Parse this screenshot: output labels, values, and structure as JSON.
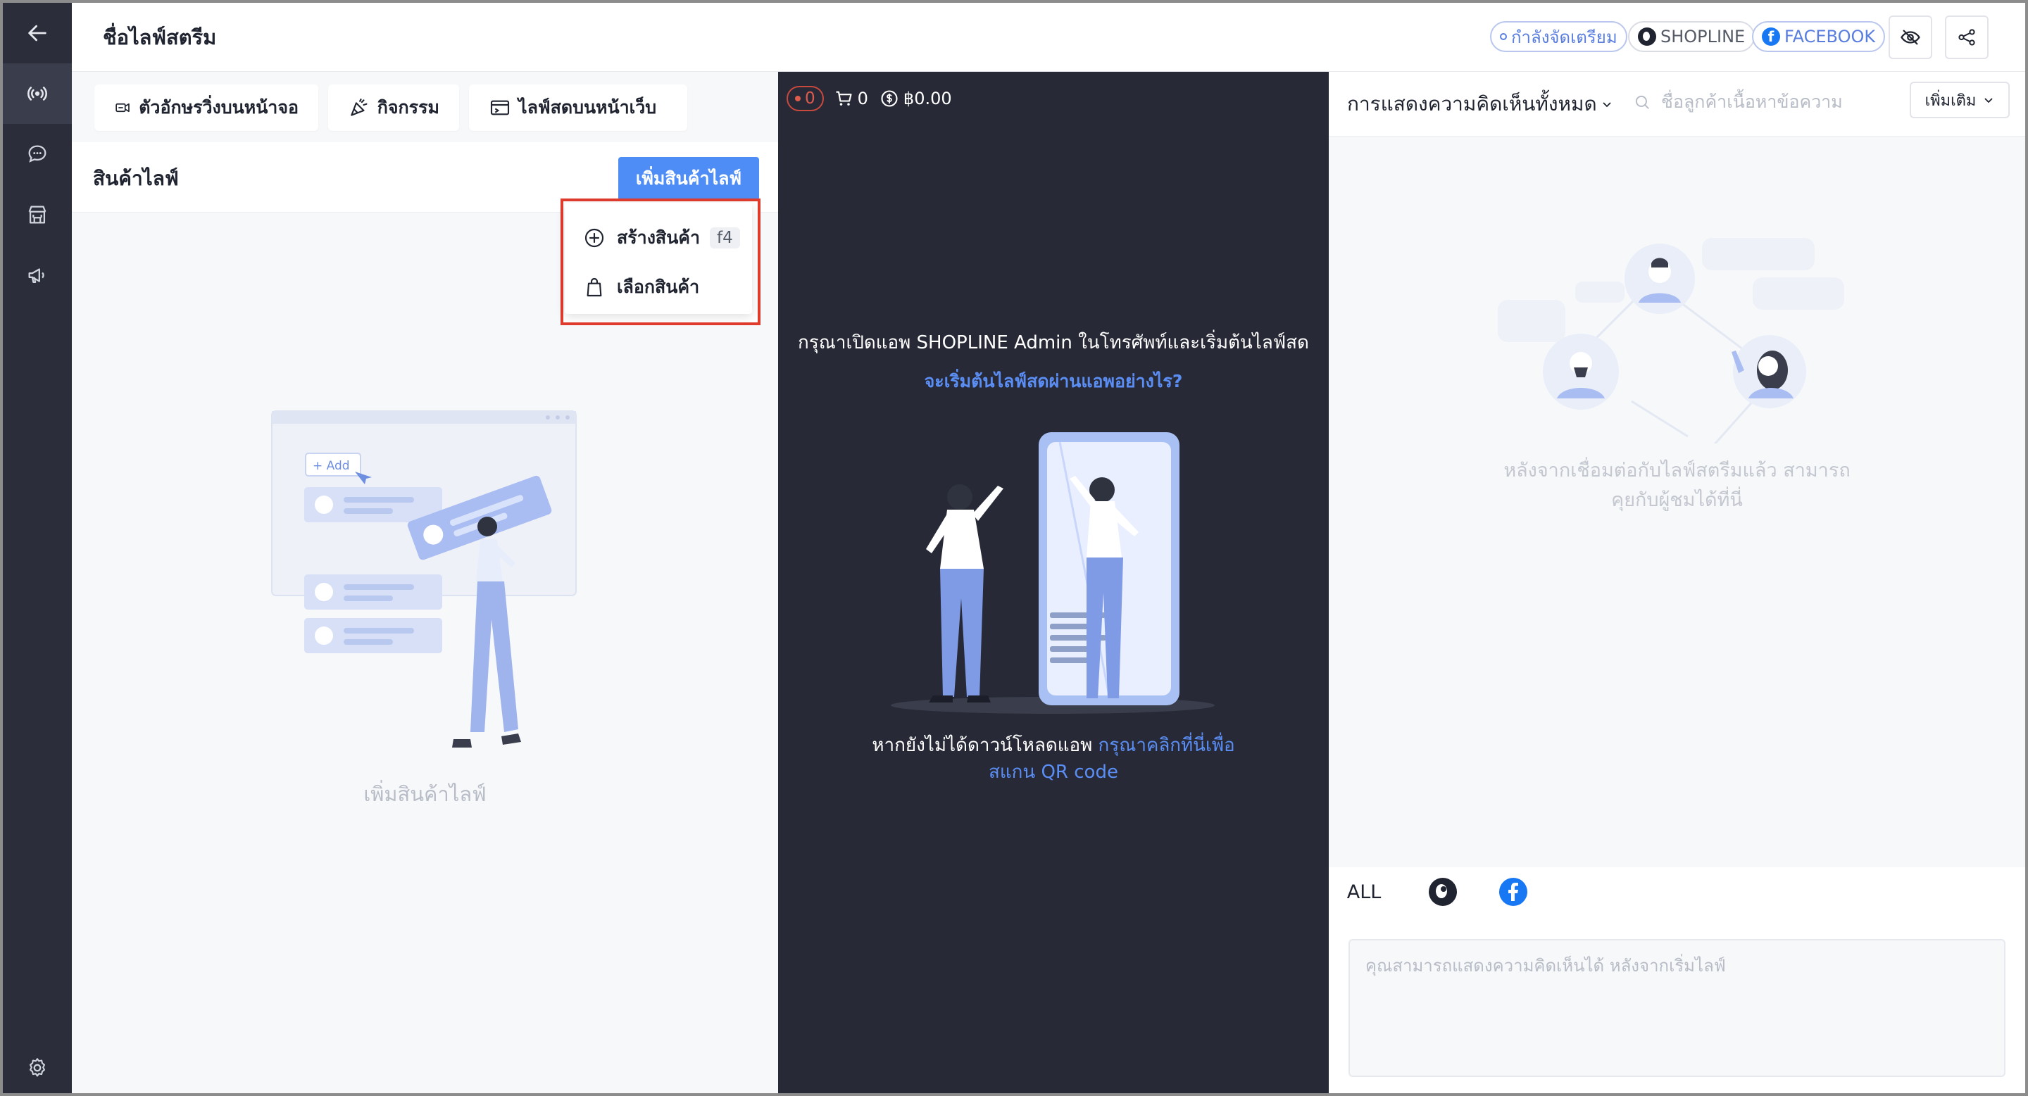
{
  "header": {
    "title": "ชื่อไลฟ์สตรีม",
    "status_label": "กำลังจัดเตรียม",
    "shopline_label": "SHOPLINE",
    "facebook_label": "FACEBOOK"
  },
  "toolbar": {
    "marquee_label": "ตัวอักษรวิ่งบนหน้าจอ",
    "activity_label": "กิจกรรม",
    "web_live_label": "ไลฟ์สดบนหน้าเว็บ"
  },
  "products": {
    "title": "สินค้าไลฟ์",
    "add_button": "เพิ่มสินค้าไลฟ์",
    "empty_text": "เพิ่มสินค้าไลฟ์",
    "illustration_add": "+ Add",
    "menu": {
      "create_label": "สร้างสินค้า",
      "create_shortcut": "f4",
      "select_label": "เลือกสินค้า"
    }
  },
  "stream": {
    "viewers": "0",
    "cart_count": "0",
    "revenue": "฿0.00",
    "message": "กรุณาเปิดแอพ SHOPLINE Admin ในโทรศัพท์และเริ่มต้นไลฟ์สด",
    "how_link": "จะเริ่มต้นไลฟ์สดผ่านแอพอย่างไร?",
    "download_text": "หากยังไม่ได้ดาวน์โหลดแอพ",
    "qr_link_line1": "กรุณาคลิกที่นี่เพื่อ",
    "qr_link_line2": "สแกน QR code"
  },
  "comments": {
    "title": "การแสดงความคิดเห็นทั้งหมด",
    "search_placeholder": "ชื่อลูกค้าเนื้อหาข้อความ",
    "more_button": "เพิ่มเติม",
    "empty_line1": "หลังจากเชื่อมต่อกับไลฟ์สตรีมแล้ว สามารถ",
    "empty_line2": "คุยกับผู้ชมได้ที่นี่",
    "tab_all": "ALL",
    "input_placeholder": "คุณสามารถแสดงความคิดเห็นได้ หลังจากเริ่มไลฟ์"
  },
  "colors": {
    "accent": "#4e8df5",
    "highlight": "#e03c2e",
    "dark_panel": "#272a36",
    "rail": "#2b2e3a",
    "facebook": "#1877f2"
  },
  "icons": [
    "back-arrow-icon",
    "live-icon",
    "chat-icon",
    "store-icon",
    "megaphone-icon",
    "settings-icon",
    "eye-off-icon",
    "share-icon",
    "search-icon",
    "plus-circle-icon",
    "bag-icon",
    "cart-icon",
    "coin-icon"
  ]
}
